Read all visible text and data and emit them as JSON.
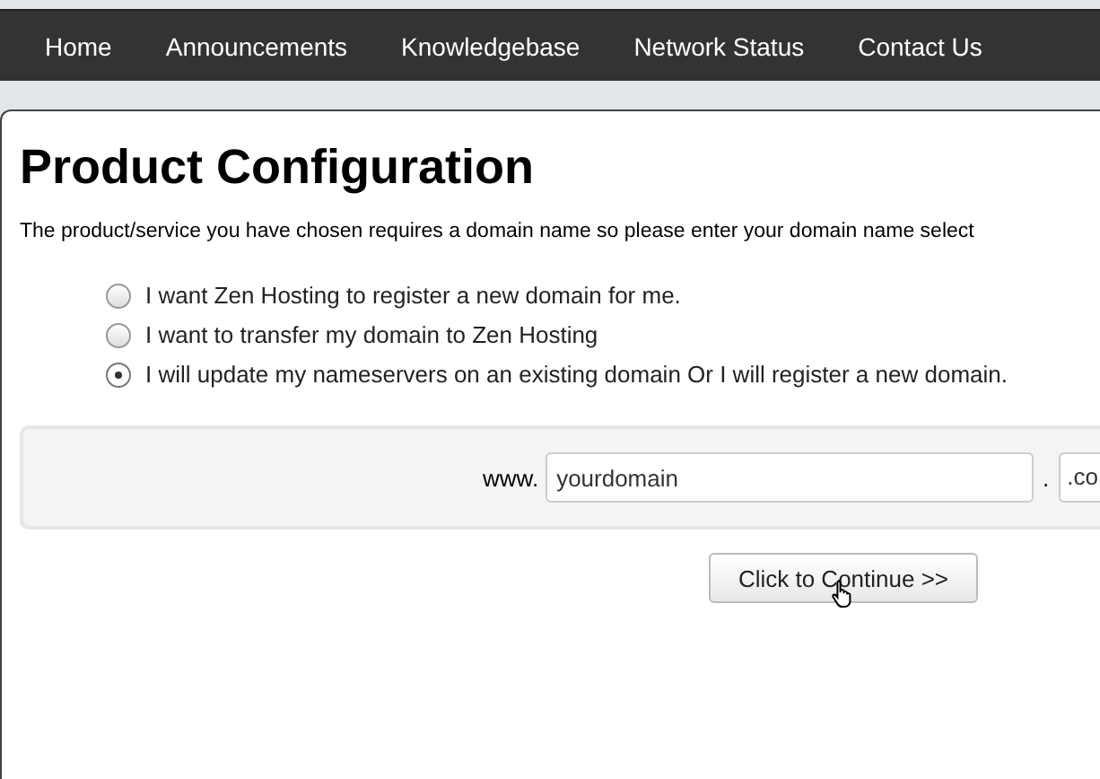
{
  "nav": [
    "Home",
    "Announcements",
    "Knowledgebase",
    "Network Status",
    "Contact Us"
  ],
  "title": "Product Configuration",
  "intro": "The product/service you have chosen requires a domain name so please enter your domain name select",
  "options": [
    {
      "label": "I want Zen Hosting to register a new domain for me.",
      "selected": false
    },
    {
      "label": "I want to transfer my domain to Zen Hosting",
      "selected": false
    },
    {
      "label": "I will update my nameservers on an existing domain Or I will register a new domain.",
      "selected": true
    }
  ],
  "domain": {
    "prefix": "www.",
    "value": "yourdomain",
    "separator": ".",
    "tld": ".co"
  },
  "button": "Click to Continue >>"
}
